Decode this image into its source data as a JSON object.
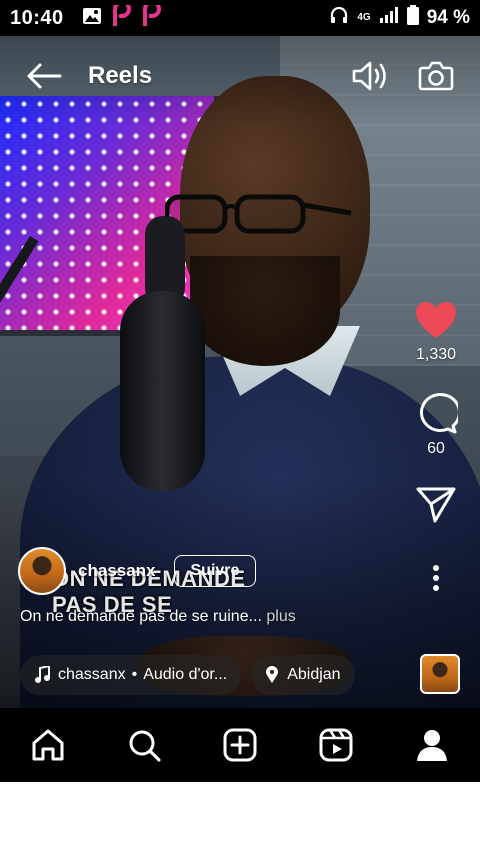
{
  "status_bar": {
    "time": "10:40",
    "network": "4G",
    "battery": "94 %"
  },
  "header": {
    "title": "Reels"
  },
  "video_overlay_text": [
    "ON NE DEMANDE",
    "PAS DE SE"
  ],
  "actions": {
    "likes": "1,330",
    "comments": "60"
  },
  "post": {
    "username": "chassanx",
    "follow_label": "Suivre",
    "caption": "On ne demande pas de se ruine...",
    "more_label": " plus",
    "audio_user": "chassanx",
    "audio_separator": "•",
    "audio_title": "Audio d'or...",
    "location": "Abidjan"
  },
  "colors": {
    "like": "#ed4956",
    "bar_bg": "#000000",
    "icon": "#ffffff"
  }
}
